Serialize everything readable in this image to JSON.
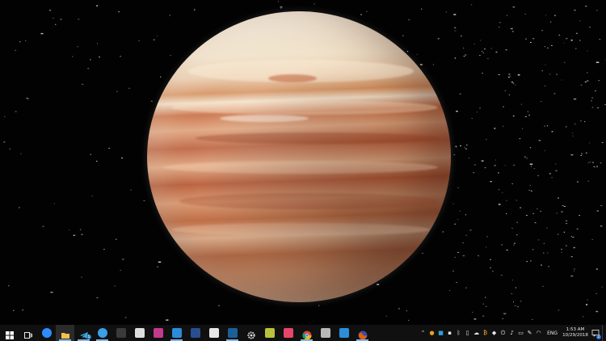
{
  "desktop": {
    "wallpaper": "gas-giant-planet-in-starfield"
  },
  "taskbar": {
    "background": "#101010",
    "accent": "#7fb6ea",
    "pinned": [
      {
        "name": "start-button",
        "icon": "windows-logo-icon",
        "color": "#ffffff"
      },
      {
        "name": "task-view-button",
        "icon": "task-view-icon",
        "color": "#ffffff"
      },
      {
        "name": "messenger-button",
        "icon": "messenger-icon",
        "color": "#2f8cff"
      },
      {
        "name": "file-explorer-button",
        "icon": "folder-icon",
        "color": "#f2c14e"
      },
      {
        "name": "telegram-button",
        "icon": "telegram-icon",
        "color": "#37aee2",
        "badge": "1"
      },
      {
        "name": "edge-button",
        "icon": "edge-icon",
        "color": "#3aa0e8"
      },
      {
        "name": "app-dark-button",
        "icon": "terminal-app-icon",
        "color": "#3a3a3a"
      },
      {
        "name": "app-grid-button",
        "icon": "screen-capture-icon",
        "color": "#dddddd"
      },
      {
        "name": "app-pink-button",
        "icon": "app-pink-icon",
        "color": "#c23a8c"
      },
      {
        "name": "vscode-button",
        "icon": "vscode-icon",
        "color": "#2b8cd9"
      },
      {
        "name": "powershell-button",
        "icon": "powershell-icon",
        "color": "#2a4d8f"
      },
      {
        "name": "slack-button",
        "icon": "slack-icon",
        "color": "#e7e7e7"
      },
      {
        "name": "steam-button",
        "icon": "steam-icon",
        "color": "#1b5f97"
      },
      {
        "name": "settings-button",
        "icon": "gear-icon",
        "color": "#e0e0e0"
      },
      {
        "name": "app-yellow-button",
        "icon": "app-yellow-icon",
        "color": "#b9c23a"
      },
      {
        "name": "app-red-button",
        "icon": "app-red-icon",
        "color": "#e8456b"
      },
      {
        "name": "chrome-button",
        "icon": "chrome-icon",
        "color": "#e7a41b"
      },
      {
        "name": "app-gray-button",
        "icon": "app-gray-icon",
        "color": "#b8b8b8"
      },
      {
        "name": "app-blue-button",
        "icon": "app-blue-icon",
        "color": "#2a8fd8"
      },
      {
        "name": "firefox-button",
        "icon": "firefox-icon",
        "color": "#e66000"
      }
    ],
    "tray_icons": [
      "chevron-up-icon",
      "chrome-tray-icon",
      "app-tray-icon",
      "network-app-icon",
      "bluetooth-icon",
      "usb-icon",
      "cloud-icon",
      "bitcoin-icon",
      "dropbox-icon",
      "power-icon",
      "volume-icon",
      "battery-icon",
      "pen-icon",
      "wifi-icon"
    ],
    "language": "ENG",
    "time": "1:53 AM",
    "date": "10/29/2018",
    "notifications_badge": "2"
  }
}
